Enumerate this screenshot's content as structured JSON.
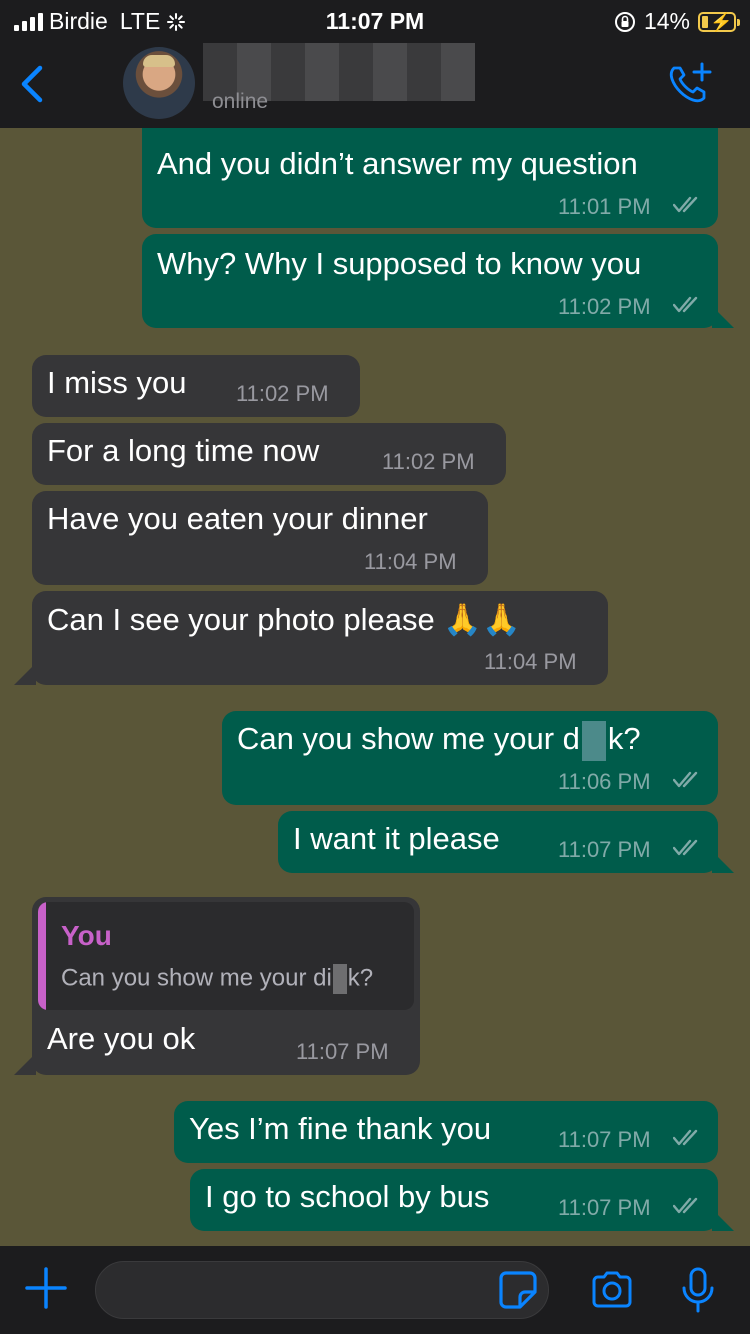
{
  "status_bar": {
    "carrier": "Birdie",
    "network": "LTE",
    "time": "11:07 PM",
    "battery": "14%"
  },
  "header": {
    "status": "online"
  },
  "messages": [
    {
      "dir": "out",
      "text": "And you didn’t answer my question",
      "time": "11:01 PM"
    },
    {
      "dir": "out",
      "text": "Why? Why I supposed to know you",
      "time": "11:02 PM"
    },
    {
      "dir": "in",
      "text": "I miss you",
      "time": "11:02 PM"
    },
    {
      "dir": "in",
      "text": "For a long time now",
      "time": "11:02 PM"
    },
    {
      "dir": "in",
      "text": "Have you eaten your dinner",
      "time": "11:04 PM"
    },
    {
      "dir": "in",
      "text": "Can I see your photo please 🙏🙏",
      "time": "11:04 PM"
    },
    {
      "dir": "out",
      "text_a": "Can you show me your d",
      "text_b": "k?",
      "time": "11:06 PM"
    },
    {
      "dir": "out",
      "text": "I want it please",
      "time": "11:07 PM"
    },
    {
      "dir": "in",
      "quote_author": "You",
      "quote_a": "Can you show me your di",
      "quote_b": "k?",
      "text": "Are you ok",
      "time": "11:07 PM"
    },
    {
      "dir": "out",
      "text": "Yes I’m fine thank you",
      "time": "11:07 PM"
    },
    {
      "dir": "out",
      "text": "I go to school by bus",
      "time": "11:07 PM"
    }
  ],
  "icons": {
    "back": "chevron-left-icon",
    "call": "add-call-icon",
    "attach": "plus-icon",
    "sticker": "sticker-icon",
    "camera": "camera-icon",
    "mic": "microphone-icon"
  },
  "colors": {
    "accent": "#0a84ff",
    "outgoing_bubble": "#005c4b",
    "incoming_bubble": "#363638",
    "quote_author": "#c861c9",
    "wallpaper": "#5a5638"
  }
}
